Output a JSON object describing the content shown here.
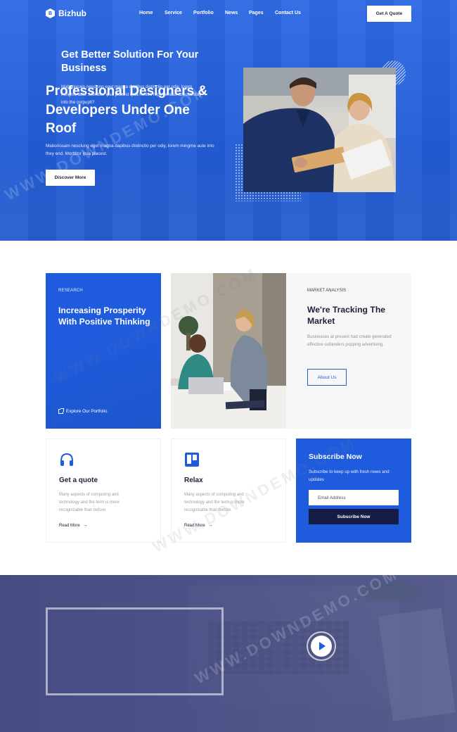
{
  "brand": {
    "logo_letter": "B",
    "name": "Bizhub",
    "accent": "#1f5cdd",
    "dark": "#171c45"
  },
  "nav": {
    "items": [
      "Home",
      "Service",
      "Portfolio",
      "News",
      "Pages",
      "Contact Us"
    ],
    "cta": "Get A Quote"
  },
  "hero": {
    "title": "Professional Designers & Developers Under One Roof",
    "text": "Maboriosam nesclung eget magna dapibus distinctio per odiy, lorem mingme aute into they end. Morttitor ipsa placest.",
    "button": "Discover More"
  },
  "research": {
    "label": "RESEARCH",
    "title": "Increasing Prosperity With Positive Thinking",
    "link": "Explore Our Portfolio"
  },
  "market": {
    "label": "MARKET ANALYSIS",
    "title": "We're Tracking The Market",
    "text": "Businesses at present had create generated effective outlanders popping advertising.",
    "button": "About Us"
  },
  "services": [
    {
      "icon": "headphones-icon",
      "title": "Get a quote",
      "text": "Many aspects of computing and technology and the term is more recognizable than before.",
      "link": "Read More"
    },
    {
      "icon": "trello-board-icon",
      "title": "Relax",
      "text": "Many aspects of computing and technology and the term is more recognizable than before.",
      "link": "Read More"
    }
  ],
  "subscribe": {
    "title": "Subscribe Now",
    "text": "Subscribe to keep up with fresh news and updates",
    "placeholder": "Email Address",
    "button": "Subscribe Now"
  },
  "cta": {
    "title": "Get Better Solution For Your Business",
    "text": "Maboriosam nesclung eget magna dapibus distinctio per odiy, lorem mingme aute .Morttitor ipsa placest quia hollitia repelgendus accusantiuy into the corpupti?"
  },
  "watermark": "WWW.DOWNDEMO.COM"
}
